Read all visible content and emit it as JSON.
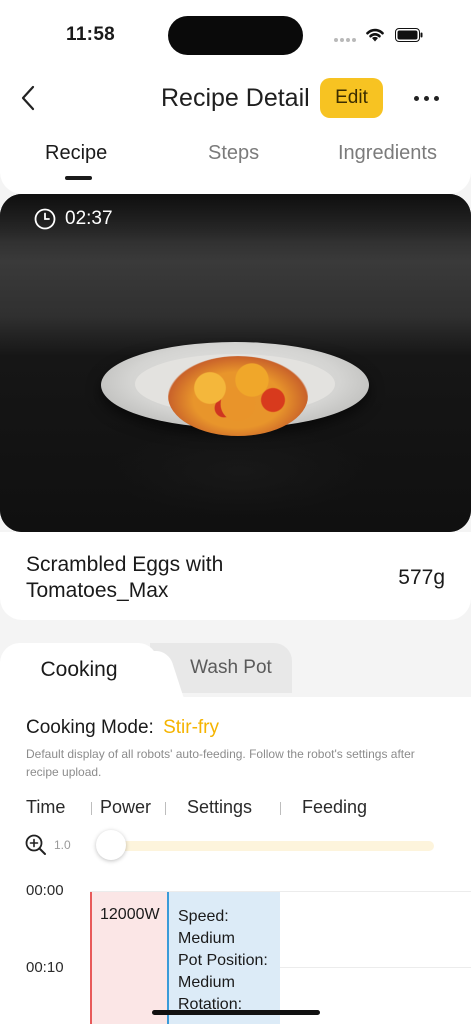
{
  "status_bar": {
    "time": "11:58"
  },
  "header": {
    "title": "Recipe Detail",
    "edit_label": "Edit",
    "tabs": [
      {
        "label": "Recipe",
        "active": true
      },
      {
        "label": "Steps",
        "active": false
      },
      {
        "label": "Ingredients",
        "active": false
      }
    ]
  },
  "media": {
    "timer": "02:37"
  },
  "recipe": {
    "name": "Scrambled Eggs with Tomatoes_Max",
    "weight": "577g"
  },
  "subtabs": {
    "cooking": "Cooking",
    "wash_pot": "Wash Pot"
  },
  "cooking": {
    "mode_label": "Cooking Mode:",
    "mode_value": "Stir-fry",
    "description": "Default display of all robots' auto-feeding. Follow the robot's settings after recipe upload.",
    "columns": [
      "Time",
      "Power",
      "Settings",
      "Feeding"
    ],
    "zoom_value": "1.0",
    "timeline": {
      "times": [
        "00:00",
        "00:10"
      ],
      "power": "12000W",
      "settings": [
        "Speed:",
        "Medium",
        "Pot Position:",
        "Medium",
        "Rotation:"
      ]
    }
  },
  "colors": {
    "accent": "#f7c322",
    "mode_text": "#f5b400",
    "power": "#e85a5a",
    "settings": "#3a9bd9"
  },
  "icons": [
    "back-icon",
    "more-icon",
    "clock-icon",
    "zoom-in-icon",
    "wifi-icon",
    "battery-icon",
    "signal-icon"
  ]
}
